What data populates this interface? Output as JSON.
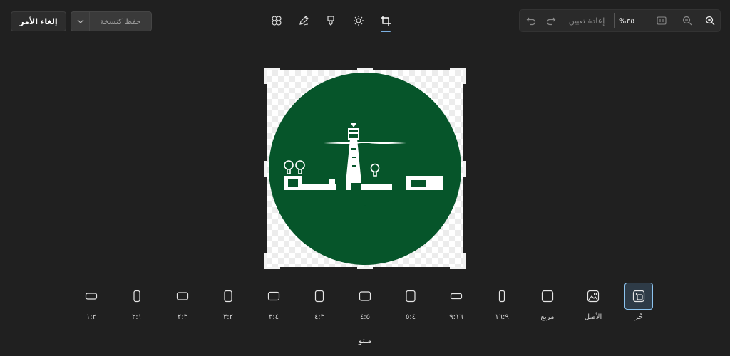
{
  "toolbar": {
    "cancel_label": "إلغاء الأمر",
    "save_label": "حفظ كنسخة",
    "tools": [
      {
        "name": "background-icon"
      },
      {
        "name": "markup-icon"
      },
      {
        "name": "retouch-icon"
      },
      {
        "name": "adjust-icon"
      },
      {
        "name": "crop-icon",
        "active": true
      }
    ]
  },
  "view": {
    "reset_label": "إعادة تعيين",
    "zoom_label": "%٣٥"
  },
  "image": {
    "logo_text": "صــــلـــة"
  },
  "ratios": [
    {
      "label": "حُر",
      "selected": true
    },
    {
      "label": "الأصل"
    },
    {
      "label": "مربع"
    },
    {
      "label": "١٦:٩"
    },
    {
      "label": "٩:١٦"
    },
    {
      "label": "٥:٤"
    },
    {
      "label": "٤:٥"
    },
    {
      "label": "٤:٣"
    },
    {
      "label": "٣:٤"
    },
    {
      "label": "٣:٢"
    },
    {
      "label": "٢:٣"
    },
    {
      "label": "٢:١"
    },
    {
      "label": "١:٢"
    }
  ],
  "flip_label": "منتو",
  "colors": {
    "accent": "#8cc4f0",
    "logo_green": "#06552a"
  }
}
